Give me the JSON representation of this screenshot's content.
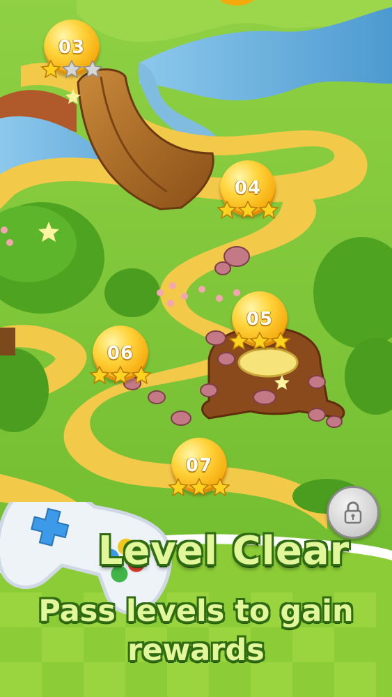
{
  "levels": [
    {
      "number": "03",
      "stars_earned": 1,
      "stars_total": 3
    },
    {
      "number": "04",
      "stars_earned": 3,
      "stars_total": 3
    },
    {
      "number": "05",
      "stars_earned": 3,
      "stars_total": 3
    },
    {
      "number": "06",
      "stars_earned": 3,
      "stars_total": 3
    },
    {
      "number": "07",
      "stars_earned": 3,
      "stars_total": 3
    }
  ],
  "locked_level": {
    "icon": "lock-icon"
  },
  "promo": {
    "title": "Level Clear",
    "subtitle_line1": "Pass levels to gain",
    "subtitle_line2": "rewards",
    "icon": "gamepad-icon"
  },
  "colors": {
    "grass": "#7cc63a",
    "path": "#f3c94a",
    "water": "#5aa9d8",
    "coin": "#ffd43c",
    "headline_text": "#e2f79a",
    "headline_outline": "#2f6b12"
  }
}
